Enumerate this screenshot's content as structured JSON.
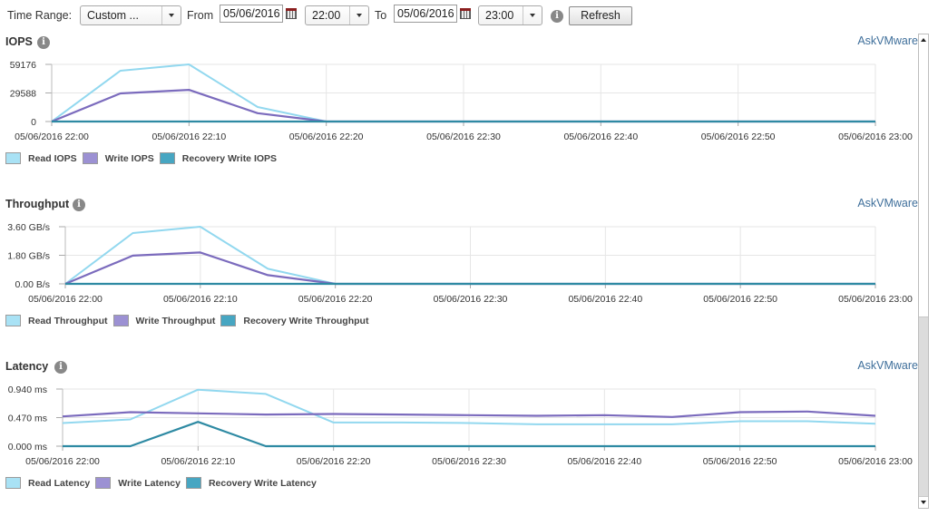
{
  "toolbar": {
    "time_range_label": "Time Range:",
    "time_range_value": "Custom ...",
    "from_label": "From",
    "from_date": "05/06/2016",
    "from_time": "22:00",
    "to_label": "To",
    "to_date": "05/06/2016",
    "to_time": "23:00",
    "refresh_label": "Refresh",
    "info_icon": "info-icon",
    "calendar_icon": "calendar-icon"
  },
  "link_label": "AskVMware",
  "colors": {
    "read": "#92d8ef",
    "write": "#7b6bbd",
    "recovery": "#2e8aa3",
    "read_swatch": "#a9e2f5",
    "write_swatch": "#9c91d3",
    "recovery_swatch": "#47a6c2",
    "grid": "#e6e6e6",
    "link": "#3f6f9b"
  },
  "chart_data": [
    {
      "type": "line",
      "title": "IOPS",
      "xlabel": "",
      "ylabel": "",
      "x": [
        "22:00",
        "22:05",
        "22:10",
        "22:15",
        "22:20",
        "22:25",
        "22:30",
        "22:35",
        "22:40",
        "22:45",
        "22:50",
        "22:55",
        "23:00"
      ],
      "x_tick_labels": [
        "05/06/2016 22:00",
        "05/06/2016 22:10",
        "05/06/2016 22:20",
        "05/06/2016 22:30",
        "05/06/2016 22:40",
        "05/06/2016 22:50",
        "05/06/2016 23:00"
      ],
      "y_tick_labels": [
        "0",
        "29588",
        "59176"
      ],
      "ylim": [
        0,
        59176
      ],
      "grid": true,
      "legend_position": "bottom-left",
      "series": [
        {
          "name": "Read IOPS",
          "key": "read",
          "values": [
            0,
            52600,
            59176,
            15000,
            0,
            0,
            0,
            0,
            0,
            0,
            0,
            0,
            0
          ]
        },
        {
          "name": "Write IOPS",
          "key": "write",
          "values": [
            0,
            29100,
            32800,
            8600,
            0,
            0,
            0,
            0,
            0,
            0,
            0,
            0,
            0
          ]
        },
        {
          "name": "Recovery Write IOPS",
          "key": "recovery",
          "values": [
            0,
            0,
            0,
            0,
            0,
            0,
            0,
            0,
            0,
            0,
            0,
            0,
            0
          ]
        }
      ]
    },
    {
      "type": "line",
      "title": "Throughput",
      "xlabel": "",
      "ylabel": "",
      "x": [
        "22:00",
        "22:05",
        "22:10",
        "22:15",
        "22:20",
        "22:25",
        "22:30",
        "22:35",
        "22:40",
        "22:45",
        "22:50",
        "22:55",
        "23:00"
      ],
      "x_tick_labels": [
        "05/06/2016 22:00",
        "05/06/2016 22:10",
        "05/06/2016 22:20",
        "05/06/2016 22:30",
        "05/06/2016 22:40",
        "05/06/2016 22:50",
        "05/06/2016 23:00"
      ],
      "y_tick_labels": [
        "0.00 B/s",
        "1.80 GB/s",
        "3.60 GB/s"
      ],
      "ylim": [
        0,
        3.6
      ],
      "y_unit": "GB/s",
      "grid": true,
      "legend_position": "bottom-left",
      "series": [
        {
          "name": "Read Throughput",
          "key": "read",
          "values": [
            0,
            3.2,
            3.6,
            0.95,
            0,
            0,
            0,
            0,
            0,
            0,
            0,
            0,
            0
          ]
        },
        {
          "name": "Write Throughput",
          "key": "write",
          "values": [
            0,
            1.78,
            1.98,
            0.55,
            0,
            0,
            0,
            0,
            0,
            0,
            0,
            0,
            0
          ]
        },
        {
          "name": "Recovery Write Throughput",
          "key": "recovery",
          "values": [
            0,
            0,
            0,
            0,
            0,
            0,
            0,
            0,
            0,
            0,
            0,
            0,
            0
          ]
        }
      ]
    },
    {
      "type": "line",
      "title": "Latency",
      "xlabel": "",
      "ylabel": "",
      "x": [
        "22:00",
        "22:05",
        "22:10",
        "22:15",
        "22:20",
        "22:25",
        "22:30",
        "22:35",
        "22:40",
        "22:45",
        "22:50",
        "22:55",
        "23:00"
      ],
      "x_tick_labels": [
        "05/06/2016 22:00",
        "05/06/2016 22:10",
        "05/06/2016 22:20",
        "05/06/2016 22:30",
        "05/06/2016 22:40",
        "05/06/2016 22:50",
        "05/06/2016 23:00"
      ],
      "y_tick_labels": [
        "0.000 ms",
        "0.470 ms",
        "0.940 ms"
      ],
      "ylim": [
        0,
        0.94
      ],
      "y_unit": "ms",
      "grid": true,
      "legend_position": "bottom-left",
      "series": [
        {
          "name": "Read Latency",
          "key": "read",
          "values": [
            0.38,
            0.44,
            0.93,
            0.86,
            0.39,
            0.39,
            0.38,
            0.36,
            0.36,
            0.36,
            0.41,
            0.41,
            0.37
          ]
        },
        {
          "name": "Write Latency",
          "key": "write",
          "values": [
            0.49,
            0.56,
            0.54,
            0.52,
            0.53,
            0.52,
            0.51,
            0.5,
            0.51,
            0.48,
            0.56,
            0.57,
            0.5
          ]
        },
        {
          "name": "Recovery Write Latency",
          "key": "recovery",
          "values": [
            0,
            0,
            0.4,
            0,
            0,
            0,
            0,
            0,
            0,
            0,
            0,
            0,
            0
          ]
        }
      ]
    }
  ],
  "scrollbar": {
    "position_fraction": 0.0,
    "visible_fraction": 0.6
  }
}
